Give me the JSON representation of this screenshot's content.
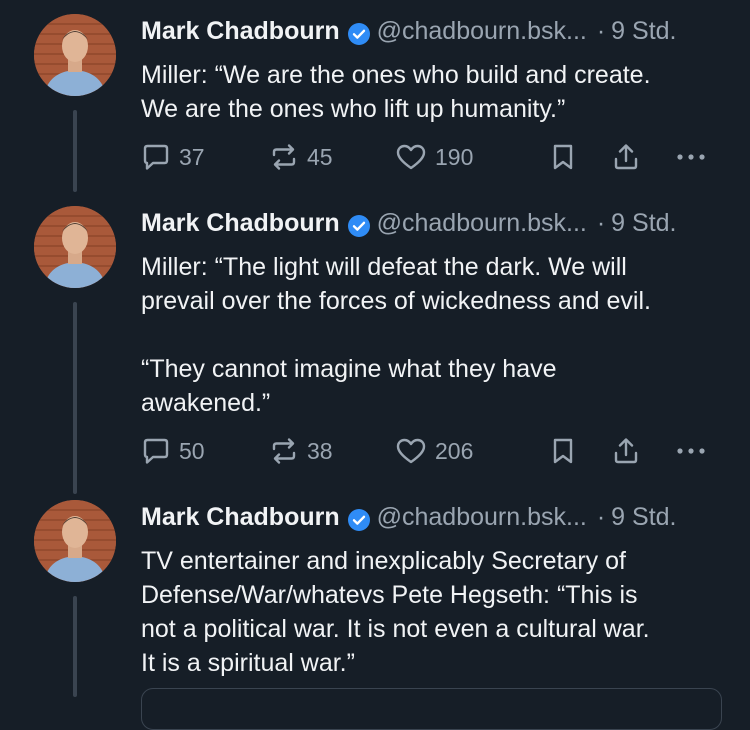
{
  "posts": [
    {
      "author": "Mark Chadbourn",
      "handle": "@chadbourn.bsk...",
      "separator": "·",
      "time": "9 Std.",
      "text": "Miller: “We are the ones who build and create.\nWe are the ones who lift up humanity.”",
      "replies": "37",
      "reposts": "45",
      "likes": "190"
    },
    {
      "author": "Mark Chadbourn",
      "handle": "@chadbourn.bsk...",
      "separator": "·",
      "time": "9 Std.",
      "text": "Miller: “The light will defeat the dark. We will\nprevail over the forces of wickedness and evil.\n\n“They cannot imagine what they have\nawakened.”",
      "replies": "50",
      "reposts": "38",
      "likes": "206"
    },
    {
      "author": "Mark Chadbourn",
      "handle": "@chadbourn.bsk...",
      "separator": "·",
      "time": "9 Std.",
      "text": "TV entertainer and inexplicably Secretary of\nDefense/War/whatevs Pete Hegseth: “This is\nnot a political war. It is not even a cultural war.\nIt is a spiritual war.”"
    }
  ],
  "icons": {
    "verified": "verified-badge-icon",
    "reply": "speech-bubble-icon",
    "repost": "repost-arrows-icon",
    "like": "heart-icon",
    "bookmark": "bookmark-icon",
    "share": "share-upload-icon",
    "more": "more-dots-icon"
  },
  "colors": {
    "background": "#161e27",
    "text": "#f1f3f5",
    "muted": "#9aa5b1",
    "verified": "#2f8cf6",
    "thread_line": "#3a4450"
  }
}
